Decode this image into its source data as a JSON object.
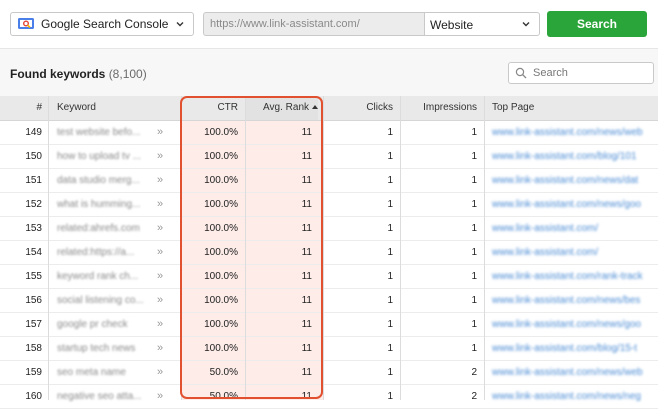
{
  "toolbar": {
    "source_label": "Google Search Console",
    "url_placeholder": "https://www.link-assistant.com/",
    "scope_label": "Website",
    "search_button": "Search"
  },
  "panel": {
    "title": "Found keywords",
    "count": "(8,100)",
    "search_placeholder": "Search"
  },
  "columns": [
    "#",
    "Keyword",
    "CTR",
    "Avg. Rank",
    "Clicks",
    "Impressions",
    "Top Page"
  ],
  "sort": {
    "column": "Avg. Rank",
    "direction": "ascending"
  },
  "rows": [
    {
      "n": "149",
      "keyword": "test website befo...",
      "ctr": "100.0%",
      "rank": "11",
      "clicks": "1",
      "impressions": "1",
      "page": "www.link-assistant.com/news/web"
    },
    {
      "n": "150",
      "keyword": "how to upload tv ...",
      "ctr": "100.0%",
      "rank": "11",
      "clicks": "1",
      "impressions": "1",
      "page": "www.link-assistant.com/blog/101"
    },
    {
      "n": "151",
      "keyword": "data studio merg...",
      "ctr": "100.0%",
      "rank": "11",
      "clicks": "1",
      "impressions": "1",
      "page": "www.link-assistant.com/news/dat"
    },
    {
      "n": "152",
      "keyword": "what is humming...",
      "ctr": "100.0%",
      "rank": "11",
      "clicks": "1",
      "impressions": "1",
      "page": "www.link-assistant.com/news/goo"
    },
    {
      "n": "153",
      "keyword": "related:ahrefs.com",
      "ctr": "100.0%",
      "rank": "11",
      "clicks": "1",
      "impressions": "1",
      "page": "www.link-assistant.com/"
    },
    {
      "n": "154",
      "keyword": "related:https://a...",
      "ctr": "100.0%",
      "rank": "11",
      "clicks": "1",
      "impressions": "1",
      "page": "www.link-assistant.com/"
    },
    {
      "n": "155",
      "keyword": "keyword rank ch...",
      "ctr": "100.0%",
      "rank": "11",
      "clicks": "1",
      "impressions": "1",
      "page": "www.link-assistant.com/rank-track"
    },
    {
      "n": "156",
      "keyword": "social listening co...",
      "ctr": "100.0%",
      "rank": "11",
      "clicks": "1",
      "impressions": "1",
      "page": "www.link-assistant.com/news/bes"
    },
    {
      "n": "157",
      "keyword": "google pr check",
      "ctr": "100.0%",
      "rank": "11",
      "clicks": "1",
      "impressions": "1",
      "page": "www.link-assistant.com/news/goo"
    },
    {
      "n": "158",
      "keyword": "startup tech news",
      "ctr": "100.0%",
      "rank": "11",
      "clicks": "1",
      "impressions": "1",
      "page": "www.link-assistant.com/blog/15-t"
    },
    {
      "n": "159",
      "keyword": "seo meta name",
      "ctr": "50.0%",
      "rank": "11",
      "clicks": "1",
      "impressions": "2",
      "page": "www.link-assistant.com/news/web"
    },
    {
      "n": "160",
      "keyword": "negative seo atta...",
      "ctr": "50.0%",
      "rank": "11",
      "clicks": "1",
      "impressions": "2",
      "page": "www.link-assistant.com/news/neg"
    }
  ],
  "colors": {
    "accent": "#e1502f",
    "highlight_bg": "#fdece8",
    "search_button": "#2aa53a",
    "link": "#4a8bd4"
  }
}
